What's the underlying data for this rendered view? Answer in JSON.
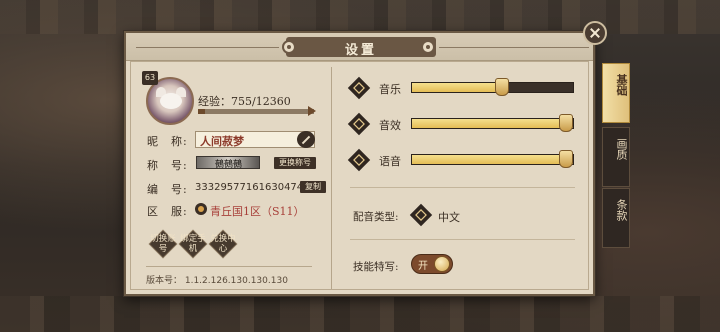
{
  "dialog": {
    "title": "设置"
  },
  "profile": {
    "level": "63",
    "exp_label": "经验：",
    "exp_value": "755/12360",
    "exp_progress": 0.061,
    "nickname_label": "昵　称:",
    "nickname": "人间菽梦",
    "title_label": "称　号:",
    "title_image_text": "鵺鵺鵺",
    "change_title_button": "更换称号",
    "id_label": "编　号:",
    "id_value": "3332957716163047424",
    "copy_button": "复制",
    "server_label": "区　服:",
    "server_value": "青丘国1区（S11）",
    "actions": [
      {
        "label": "切换账号"
      },
      {
        "label": "绑定手机"
      },
      {
        "label": "兑换中心"
      }
    ],
    "version": "版本号：  1.1.2.126.130.130.130"
  },
  "audio": {
    "sliders": [
      {
        "label": "音乐",
        "value": 0.56
      },
      {
        "label": "音效",
        "value": 1.0
      },
      {
        "label": "语音",
        "value": 1.0
      }
    ],
    "voice_type_label": "配音类型:",
    "voice_type_value": "中文",
    "skill_closeup_label": "技能特写:",
    "skill_closeup_toggle": "开"
  },
  "side_tabs": [
    {
      "label": "基础",
      "active": true
    },
    {
      "label": "画质",
      "active": false
    },
    {
      "label": "条款",
      "active": false
    }
  ],
  "colors": {
    "accent": "#e4bd56",
    "panel": "#e3d8c4",
    "dark": "#3a2e25",
    "server": "#a8403a"
  }
}
